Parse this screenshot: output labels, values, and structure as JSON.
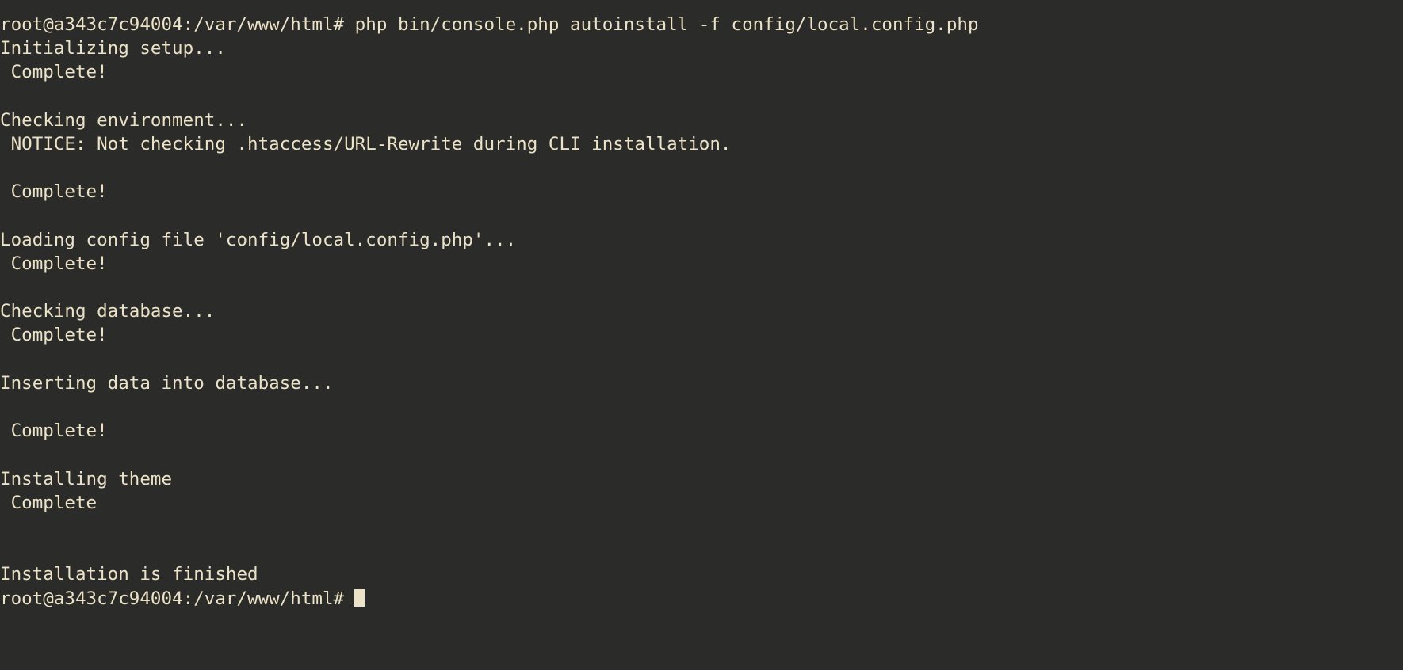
{
  "terminal": {
    "colors": {
      "background": "#2b2b29",
      "foreground": "#ece3c6",
      "cursor": "#ece3c6"
    },
    "hostname": "a343c7c94004",
    "user": "root",
    "cwd": "/var/www/html",
    "prompt": "root@a343c7c94004:/var/www/html# ",
    "command": "php bin/console.php autoinstall -f config/local.config.php",
    "lines": [
      "root@a343c7c94004:/var/www/html# php bin/console.php autoinstall -f config/local.config.php",
      "Initializing setup...",
      " Complete!",
      "",
      "Checking environment...",
      " NOTICE: Not checking .htaccess/URL-Rewrite during CLI installation.",
      "",
      " Complete!",
      "",
      "Loading config file 'config/local.config.php'...",
      " Complete!",
      "",
      "Checking database...",
      " Complete!",
      "",
      "Inserting data into database...",
      "",
      " Complete!",
      "",
      "Installing theme",
      " Complete",
      "",
      "",
      "Installation is finished"
    ],
    "final_prompt": "root@a343c7c94004:/var/www/html#",
    "cursor_visible": true
  }
}
